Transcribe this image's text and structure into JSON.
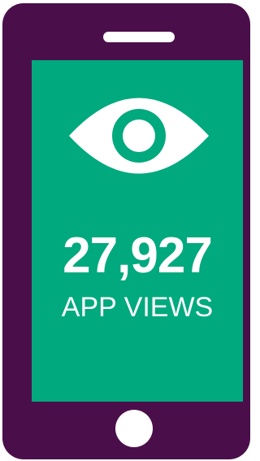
{
  "stat": {
    "value": "27,927",
    "label": "APP VIEWS"
  },
  "icons": {
    "main": "eye-icon"
  },
  "colors": {
    "phone_body": "#4a0f4a",
    "screen": "#00a97e",
    "foreground": "#ffffff"
  }
}
